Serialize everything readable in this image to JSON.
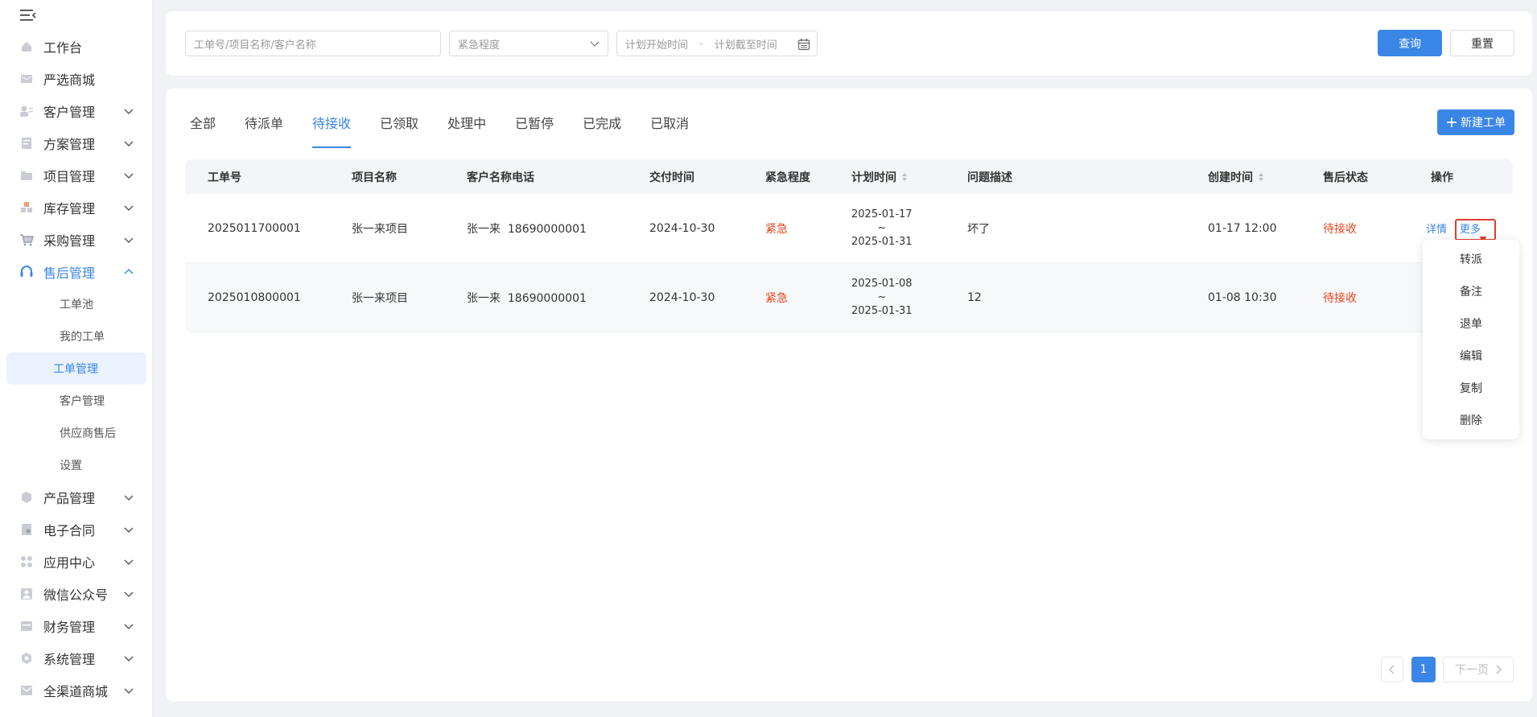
{
  "sidebar": {
    "items": [
      {
        "label": "工作台",
        "icon": "home-icon"
      },
      {
        "label": "严选商城",
        "icon": "mail-icon"
      },
      {
        "label": "客户管理",
        "icon": "user-card-icon"
      },
      {
        "label": "方案管理",
        "icon": "document-icon"
      },
      {
        "label": "项目管理",
        "icon": "folder-icon"
      },
      {
        "label": "库存管理",
        "icon": "blocks-icon"
      },
      {
        "label": "采购管理",
        "icon": "cart-icon"
      },
      {
        "label": "售后管理",
        "icon": "headset-icon"
      }
    ],
    "sub_items": [
      "工单池",
      "我的工单",
      "工单管理",
      "客户管理",
      "供应商售后",
      "设置"
    ],
    "items_after": [
      {
        "label": "产品管理",
        "icon": "box-icon"
      },
      {
        "label": "电子合同",
        "icon": "contract-icon"
      },
      {
        "label": "应用中心",
        "icon": "apps-icon"
      },
      {
        "label": "微信公众号",
        "icon": "person-icon"
      },
      {
        "label": "财务管理",
        "icon": "finance-icon"
      },
      {
        "label": "系统管理",
        "icon": "gear-icon"
      },
      {
        "label": "全渠道商城",
        "icon": "envelope-icon"
      }
    ]
  },
  "filter": {
    "search_placeholder": "工单号/项目名称/客户名称",
    "urgency_placeholder": "紧急程度",
    "start_placeholder": "计划开始时间",
    "date_sep": "-",
    "end_placeholder": "计划截至时间",
    "query_label": "查询",
    "reset_label": "重置"
  },
  "tabs": [
    "全部",
    "待派单",
    "待接收",
    "已领取",
    "处理中",
    "已暂停",
    "已完成",
    "已取消"
  ],
  "new_button": "新建工单",
  "table": {
    "headers": [
      "工单号",
      "项目名称",
      "客户名称电话",
      "交付时间",
      "紧急程度",
      "计划时间",
      "问题描述",
      "创建时间",
      "售后状态",
      "操作"
    ],
    "rows": [
      {
        "id": "2025011700001",
        "project": "张一来项目",
        "customer": "张一来  18690000001",
        "delivery": "2024-10-30",
        "urgency": "紧急",
        "plan_start": "2025-01-17",
        "plan_sep": "~",
        "plan_end": "2025-01-31",
        "desc": "坏了",
        "created": "01-17 12:00",
        "status": "待接收",
        "op_detail": "详情",
        "op_more": "更多"
      },
      {
        "id": "2025010800001",
        "project": "张一来项目",
        "customer": "张一来  18690000001",
        "delivery": "2024-10-30",
        "urgency": "紧急",
        "plan_start": "2025-01-08",
        "plan_sep": "~",
        "plan_end": "2025-01-31",
        "desc": "12",
        "created": "01-08 10:30",
        "status": "待接收"
      }
    ]
  },
  "dropdown": [
    "转派",
    "备注",
    "退单",
    "编辑",
    "复制",
    "删除"
  ],
  "pagination": {
    "current": "1",
    "next_label": "下一页"
  },
  "colors": {
    "primary": "#3a86e6",
    "danger": "#e8451f",
    "highlight": "#e03c31"
  }
}
